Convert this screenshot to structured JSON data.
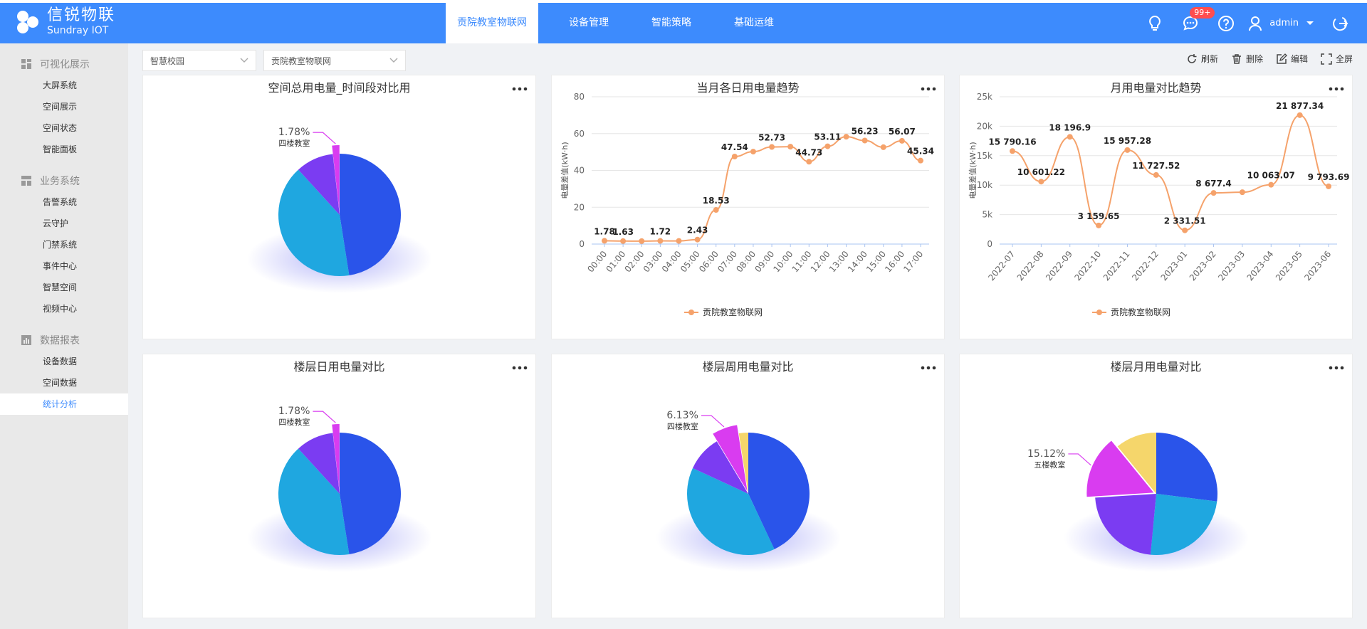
{
  "brand": {
    "name_cn": "信锐物联",
    "name_en": "Sundray IOT"
  },
  "nav": [
    {
      "label": "贡院教室物联网",
      "active": true
    },
    {
      "label": "设备管理",
      "active": false
    },
    {
      "label": "智能策略",
      "active": false
    },
    {
      "label": "基础运维",
      "active": false
    }
  ],
  "header": {
    "badge": "99+",
    "user": "admin"
  },
  "sidebar": {
    "groups": [
      {
        "label": "可视化展示",
        "icon": "dashboard-icon",
        "items": [
          {
            "label": "大屏系统"
          },
          {
            "label": "空间展示"
          },
          {
            "label": "空间状态"
          },
          {
            "label": "智能面板"
          }
        ]
      },
      {
        "label": "业务系统",
        "icon": "business-icon",
        "items": [
          {
            "label": "告警系统"
          },
          {
            "label": "云守护"
          },
          {
            "label": "门禁系统"
          },
          {
            "label": "事件中心"
          },
          {
            "label": "智慧空间"
          },
          {
            "label": "视频中心"
          }
        ]
      },
      {
        "label": "数据报表",
        "icon": "report-icon",
        "items": [
          {
            "label": "设备数据"
          },
          {
            "label": "空间数据"
          },
          {
            "label": "统计分析",
            "active": true
          }
        ]
      }
    ]
  },
  "filters": {
    "campus": "智慧校园",
    "project": "贡院教室物联网"
  },
  "actions": {
    "refresh": "刷新",
    "delete": "删除",
    "edit": "编辑",
    "fullscreen": "全屏"
  },
  "colors": {
    "accent": "#3d8bfd",
    "line": "#f5a26b",
    "pie": [
      "#2a54ea",
      "#1fa7e0",
      "#7b3cf2",
      "#d93cf0",
      "#f5d66b"
    ]
  },
  "chart_data": [
    {
      "type": "pie",
      "title": "空间总用电量_时间段对比用",
      "slices": [
        {
          "value": 47.5
        },
        {
          "value": 40.72
        },
        {
          "value": 10.0
        },
        {
          "name": "四楼教室",
          "value": 1.78,
          "label": "1.78%"
        }
      ]
    },
    {
      "type": "line",
      "title": "当月各日用电量趋势",
      "ylabel": "电量差值(kW·h)",
      "ylim": [
        0,
        80
      ],
      "yticks": [
        "0",
        "20",
        "40",
        "60",
        "80"
      ],
      "x": [
        "00:00",
        "01:00",
        "02:00",
        "03:00",
        "04:00",
        "05:00",
        "06:00",
        "07:00",
        "08:00",
        "09:00",
        "10:00",
        "11:00",
        "12:00",
        "13:00",
        "14:00",
        "15:00",
        "16:00",
        "17:00"
      ],
      "series": [
        {
          "name": "贡院教室物联网",
          "values": [
            1.78,
            1.63,
            1.6,
            1.72,
            1.7,
            2.43,
            18.53,
            47.54,
            50.2,
            52.73,
            52.9,
            44.73,
            53.11,
            58.3,
            56.23,
            52.6,
            56.07,
            45.34
          ],
          "labels": [
            "1.78",
            "1.63",
            "",
            "1.72",
            "",
            "2.43",
            "18.53",
            "47.54",
            "",
            "52.73",
            "",
            "44.73",
            "53.11",
            "",
            "56.23",
            "",
            "56.07",
            "45.34"
          ]
        }
      ],
      "legend": "bottom"
    },
    {
      "type": "line",
      "title": "月用电量对比趋势",
      "ylabel": "电量差值(kW·h)",
      "ylim": [
        0,
        25000
      ],
      "yticks": [
        "0",
        "5k",
        "10k",
        "15k",
        "20k",
        "25k"
      ],
      "x": [
        "2022-07",
        "2022-08",
        "2022-09",
        "2022-10",
        "2022-11",
        "2022-12",
        "2023-01",
        "2023-02",
        "2023-03",
        "2023-04",
        "2023-05",
        "2023-06"
      ],
      "series": [
        {
          "name": "贡院教室物联网",
          "values": [
            15790.16,
            10601.22,
            18196.9,
            3159.65,
            15957.28,
            11727.52,
            2331.51,
            8677.4,
            8800,
            10063.07,
            21877.34,
            9793.69
          ],
          "labels": [
            "15 790.16",
            "10 601.22",
            "18 196.9",
            "3 159.65",
            "15 957.28",
            "11 727.52",
            "2 331.51",
            "8 677.4",
            "",
            "10 063.07",
            "21 877.34",
            "9 793.69"
          ]
        }
      ],
      "legend": "bottom"
    },
    {
      "type": "pie",
      "title": "楼层日用电量对比",
      "slices": [
        {
          "value": 47.5
        },
        {
          "value": 40.72
        },
        {
          "value": 10.0
        },
        {
          "name": "四楼教室",
          "value": 1.78,
          "label": "1.78%"
        }
      ]
    },
    {
      "type": "pie",
      "title": "楼层周用电量对比",
      "slices": [
        {
          "value": 43.0
        },
        {
          "value": 38.9
        },
        {
          "value": 9.5
        },
        {
          "name": "四楼教室",
          "value": 6.13,
          "label": "6.13%"
        },
        {
          "value": 2.47
        }
      ]
    },
    {
      "type": "pie",
      "title": "楼层月用电量对比",
      "slices": [
        {
          "value": 27.0
        },
        {
          "value": 24.5
        },
        {
          "value": 22.5
        },
        {
          "name": "五楼教室",
          "value": 15.12,
          "label": "15.12%"
        },
        {
          "value": 10.88
        }
      ]
    }
  ]
}
